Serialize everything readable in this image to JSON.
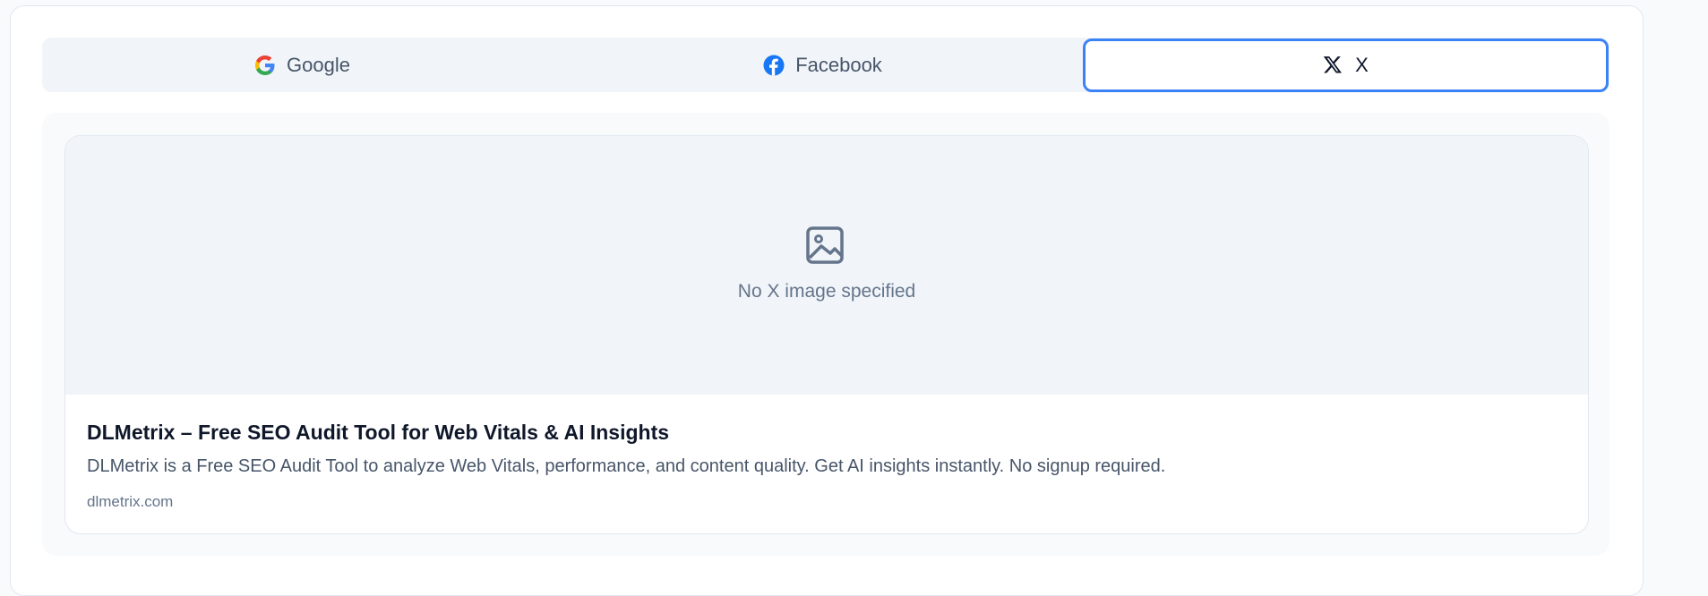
{
  "tabs": [
    {
      "label": "Google",
      "icon": "google-icon",
      "active": false
    },
    {
      "label": "Facebook",
      "icon": "facebook-icon",
      "active": false
    },
    {
      "label": "X",
      "icon": "x-logo-icon",
      "active": true
    }
  ],
  "preview": {
    "placeholder_icon": "image-icon",
    "placeholder_text": "No X image specified",
    "title": "DLMetrix – Free SEO Audit Tool for Web Vitals & AI Insights",
    "description": "DLMetrix is a Free SEO Audit Tool to analyze Web Vitals, performance, and content quality. Get AI insights instantly. No signup required.",
    "domain": "dlmetrix.com"
  },
  "colors": {
    "active_border": "#3b82f6",
    "facebook_blue": "#1877f2"
  }
}
